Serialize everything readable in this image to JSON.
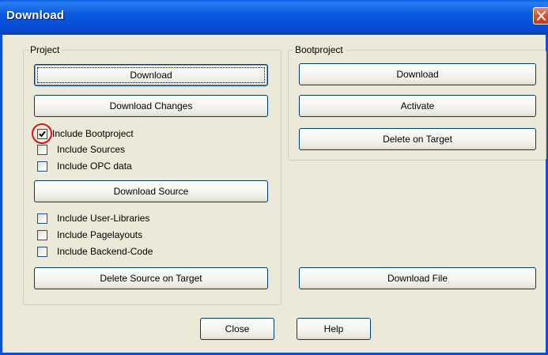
{
  "window": {
    "title": "Download"
  },
  "project": {
    "legend": "Project",
    "download_button": "Download",
    "download_changes_button": "Download Changes",
    "include_bootproject": {
      "label": "Include Bootproject",
      "checked": true
    },
    "include_sources": {
      "label": "Include Sources",
      "checked": false
    },
    "include_opc_data": {
      "label": "Include OPC data",
      "checked": false
    },
    "download_source_button": "Download Source",
    "include_user_libraries": {
      "label": "Include User-Libraries",
      "checked": false
    },
    "include_pagelayouts": {
      "label": "Include Pagelayouts",
      "checked": false
    },
    "include_backend_code": {
      "label": "Include Backend-Code",
      "checked": false
    },
    "delete_source_button": "Delete Source on Target"
  },
  "bootproject": {
    "legend": "Bootproject",
    "download_button": "Download",
    "activate_button": "Activate",
    "delete_button": "Delete on Target"
  },
  "download_file_button": "Download File",
  "footer": {
    "close_button": "Close",
    "help_button": "Help"
  },
  "colors": {
    "titlebar": "#0a5ae0",
    "dialog_bg": "#ece9d8",
    "highlight_ring": "#e01020",
    "close_button": "#d5532f"
  },
  "icons": {
    "close": "close-icon",
    "check": "checkmark-icon"
  }
}
